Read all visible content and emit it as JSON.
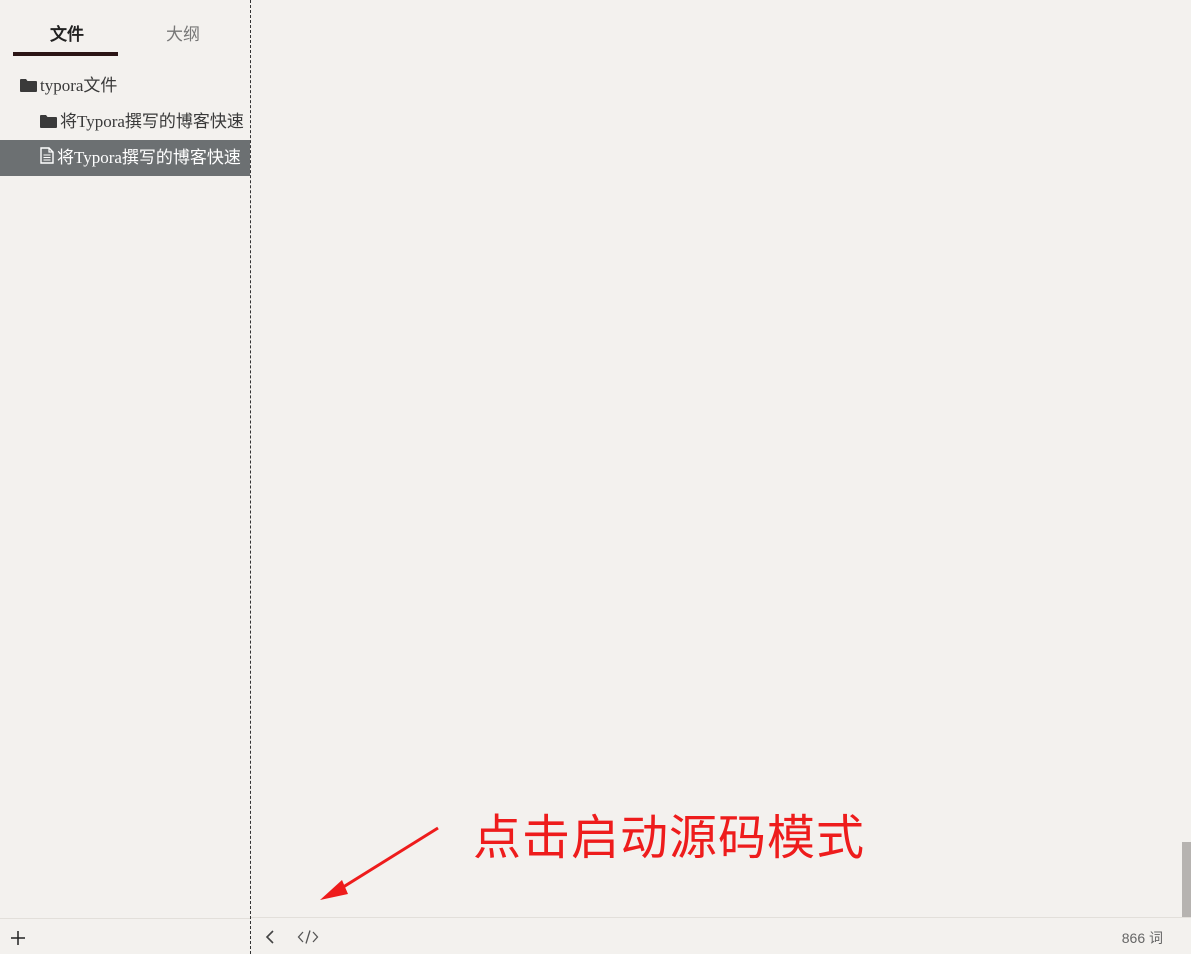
{
  "sidebar": {
    "tabs": [
      {
        "label": "文件",
        "active": true
      },
      {
        "label": "大纲",
        "active": false
      }
    ],
    "tree": [
      {
        "label": "typora文件",
        "type": "folder",
        "level": 0,
        "icon": "folder-icon"
      },
      {
        "label": "将Typora撰写的博客快速",
        "type": "folder",
        "level": 1,
        "icon": "folder-icon"
      },
      {
        "label": "将Typora撰写的博客快速",
        "type": "file",
        "level": 1,
        "icon": "file-icon",
        "active": true
      }
    ],
    "add_icon": "plus-icon"
  },
  "statusbar": {
    "back_icon": "chevron-left-icon",
    "source_icon": "code-icon",
    "word_count": "866 词"
  },
  "annotation": {
    "text": "点击启动源码模式",
    "color": "#ee1c1c"
  },
  "colors": {
    "background": "#f3f1ee",
    "active_row": "#6c7072",
    "tab_underline": "#2b1515"
  }
}
